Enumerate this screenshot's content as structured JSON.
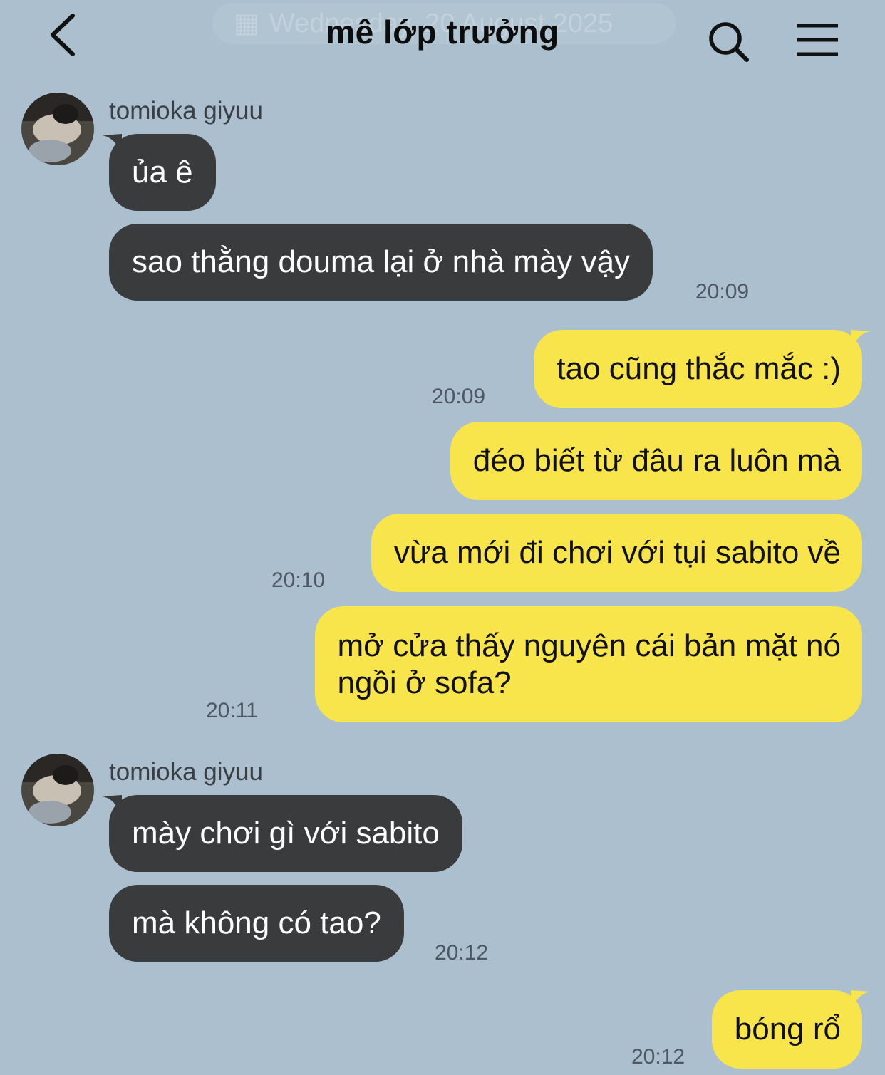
{
  "header": {
    "title": "mê lớp trưởng",
    "date_pill": "Wednesday, 20 August 2025"
  },
  "messages": [
    {
      "sender": "tomioka giyuu",
      "text": "ủa ê"
    },
    {
      "text": "sao thằng douma lại ở nhà mày vậy",
      "time": "20:09"
    },
    {
      "text": "tao cũng thắc mắc :)",
      "time": "20:09"
    },
    {
      "text": "đéo biết từ đâu ra luôn mà"
    },
    {
      "text": "vừa mới đi chơi với tụi sabito về",
      "time": "20:10"
    },
    {
      "text_line1": "mở cửa thấy nguyên cái bản mặt nó",
      "text_line2": "ngồi ở sofa?",
      "time": "20:11"
    },
    {
      "sender": "tomioka giyuu",
      "text": "mày chơi gì với sabito"
    },
    {
      "text": "mà không có tao?",
      "time": "20:12"
    },
    {
      "text": "bóng rổ",
      "time": "20:12"
    }
  ],
  "colors": {
    "background": "#abbfcf",
    "incoming_bubble": "#3a3b3d",
    "outgoing_bubble": "#f8e54b"
  },
  "icons": [
    "back-arrow-icon",
    "calendar-icon",
    "search-icon",
    "menu-icon",
    "avatar"
  ]
}
